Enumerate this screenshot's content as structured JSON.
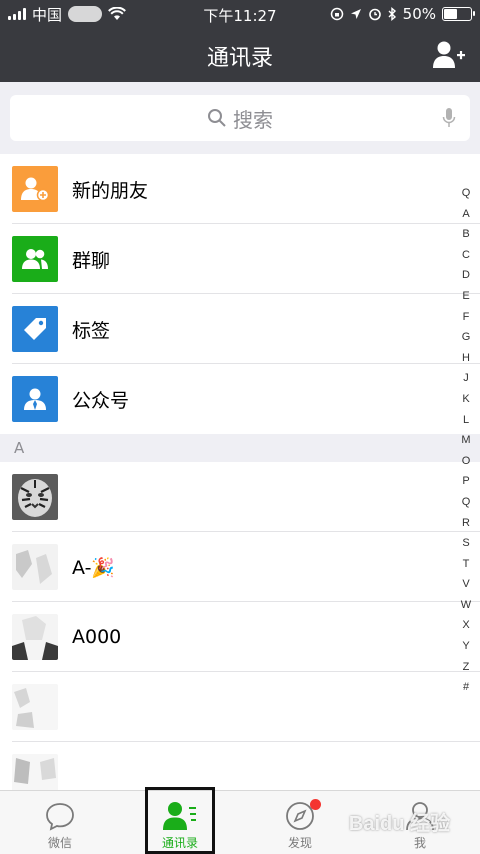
{
  "status_bar": {
    "carrier": "中国",
    "time": "下午11:27",
    "battery": "50%"
  },
  "nav": {
    "title": "通讯录",
    "add_icon": "add-friend-icon"
  },
  "search": {
    "placeholder": "搜索"
  },
  "functions": [
    {
      "label": "新的朋友",
      "icon": "new-friend-icon",
      "color": "#fa9d3b"
    },
    {
      "label": "群聊",
      "icon": "group-chat-icon",
      "color": "#1aad19"
    },
    {
      "label": "标签",
      "icon": "tag-icon",
      "color": "#2782d7"
    },
    {
      "label": "公众号",
      "icon": "official-account-icon",
      "color": "#2782d7"
    }
  ],
  "section_letter": "A",
  "contacts": [
    {
      "name": ""
    },
    {
      "name": "A-🎉"
    },
    {
      "name": "A000"
    },
    {
      "name": ""
    },
    {
      "name": ""
    }
  ],
  "index_letters": [
    "Q",
    "A",
    "B",
    "C",
    "D",
    "E",
    "F",
    "G",
    "H",
    "J",
    "K",
    "L",
    "M",
    "O",
    "P",
    "Q",
    "R",
    "S",
    "T",
    "V",
    "W",
    "X",
    "Y",
    "Z",
    "#"
  ],
  "tabs": [
    {
      "label": "微信",
      "icon": "chat-bubble-icon",
      "active": false
    },
    {
      "label": "通讯录",
      "icon": "contacts-icon",
      "active": true
    },
    {
      "label": "发现",
      "icon": "compass-icon",
      "active": false,
      "badge": true
    },
    {
      "label": "我",
      "icon": "me-icon",
      "active": false
    }
  ],
  "watermark": "Baidu 经验",
  "colors": {
    "accent": "#1aad19",
    "header": "#393a3f",
    "badge": "#f43530"
  }
}
